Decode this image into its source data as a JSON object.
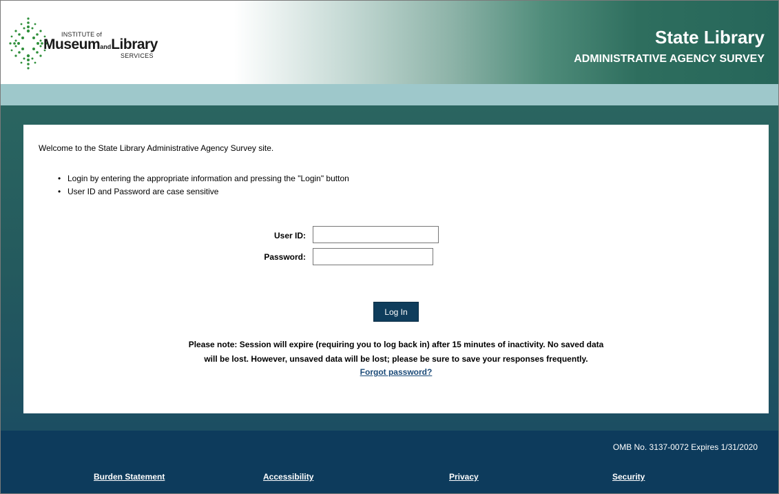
{
  "header": {
    "logo": {
      "institute": "INSTITUTE of",
      "museum": "Museum",
      "and": "and",
      "library": "Library",
      "services": "SERVICES"
    },
    "title": "State Library",
    "subtitle": "ADMINISTRATIVE AGENCY SURVEY"
  },
  "main": {
    "welcome": "Welcome to the State Library Administrative Agency Survey site.",
    "bullets": [
      "Login by entering the appropriate information and pressing the \"Login\" button",
      "User ID and Password are case sensitive"
    ],
    "form": {
      "user_id_label": "User ID:",
      "user_id_value": "",
      "password_label": "Password:",
      "password_value": "",
      "login_button": "Log In"
    },
    "note_line1": "Please note: Session will expire (requiring you to log back in) after 15 minutes of inactivity. No saved data",
    "note_line2": "will be lost. However, unsaved data will be lost; please be sure to save your responses frequently.",
    "forgot_password": "Forgot password?"
  },
  "footer": {
    "omb": "OMB No. 3137-0072   Expires 1/31/2020",
    "links": [
      "Burden Statement",
      "Accessibility",
      "Privacy",
      "Security"
    ]
  },
  "colors": {
    "header_accent": "#26665a",
    "teal_bar": "#9ec8cb",
    "background": "#2a5e5c",
    "footer": "#0d3b5c",
    "button": "#0f3d5c",
    "link": "#1a4a78"
  }
}
